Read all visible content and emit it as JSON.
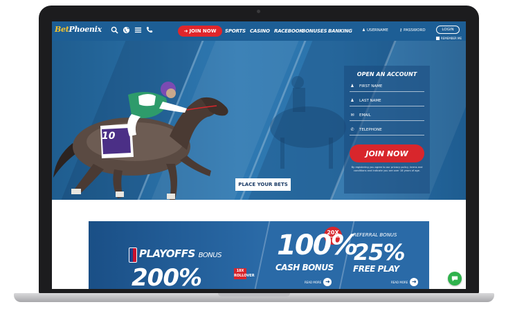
{
  "brand": {
    "logo_prefix": "Bet",
    "logo_main": "Phoenix"
  },
  "nav": {
    "icons": [
      "search-icon",
      "globe-icon",
      "menu-icon",
      "phone-icon"
    ],
    "join_label": "JOIN NOW",
    "links": [
      "SPORTS",
      "CASINO",
      "RACEBOOK",
      "BONUSES",
      "BANKING"
    ],
    "username_placeholder": "USERNAME",
    "password_placeholder": "PASSWORD",
    "login_label": "LOGIN",
    "remember_label": "REMEMBER ME"
  },
  "hero": {
    "jockey_number": "10",
    "place_bets_label": "PLACE YOUR BETS"
  },
  "signup": {
    "title": "OPEN AN ACCOUNT",
    "fields": [
      {
        "placeholder": "FIRST NAME",
        "icon": "user-icon"
      },
      {
        "placeholder": "LAST NAME",
        "icon": "user-icon"
      },
      {
        "placeholder": "EMAIL",
        "icon": "mail-icon"
      },
      {
        "placeholder": "TELEPHONE",
        "icon": "phone-icon"
      }
    ],
    "join_label": "JOIN NOW",
    "disclaimer": "By registering you agree to our privacy policy, terms and conditions and indicate you are over 18 years of age."
  },
  "promos": {
    "playoffs_title": "PLAYOFFS",
    "playoffs_bonus": "BONUS",
    "playoffs_pct": "200%",
    "playoffs_rollover": "18X ROLLOVER",
    "cash_pct": "100%",
    "cash_label": "CASH BONUS",
    "cash_rollover_num": "20X",
    "cash_rollover_text": "ROLLOVER",
    "referral_label": "REFERRAL BONUS",
    "referral_pct": "25%",
    "referral_free": "FREE PLAY",
    "read_more": "READ MORE"
  },
  "colors": {
    "nav_bg": "#1d5e95",
    "accent_red": "#d8262c",
    "hero_blue": "#2f79b2",
    "chat_green": "#2fb24c"
  }
}
